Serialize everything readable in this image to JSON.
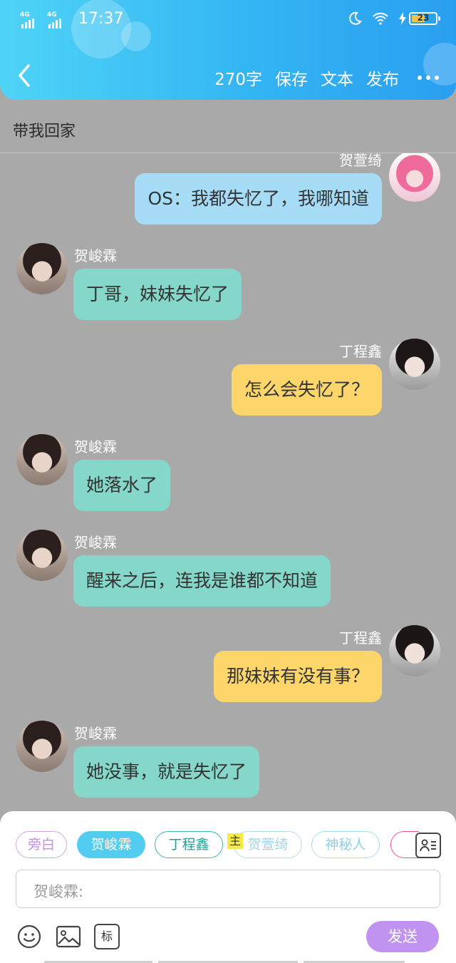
{
  "status_bar": {
    "network1": "4G",
    "network2": "4G",
    "time": "17:37",
    "battery": "23",
    "icons": [
      "moon-icon",
      "wifi-icon",
      "charging-icon",
      "battery-icon"
    ]
  },
  "header": {
    "word_count": "270字",
    "save": "保存",
    "text": "文本",
    "publish": "发布"
  },
  "title": "带我回家",
  "messages": [
    {
      "speaker": "贺萱绮",
      "text": "OS：我都失忆了，我哪知道"
    },
    {
      "speaker": "贺峻霖",
      "text": "丁哥，妹妹失忆了"
    },
    {
      "speaker": "丁程鑫",
      "text": "怎么会失忆了？"
    },
    {
      "speaker": "贺峻霖",
      "text": "她落水了"
    },
    {
      "speaker": "贺峻霖",
      "text": "醒来之后，连我是谁都不知道"
    },
    {
      "speaker": "丁程鑫",
      "text": "那妹妹有没有事？"
    },
    {
      "speaker": "贺峻霖",
      "text": "她没事，就是失忆了"
    }
  ],
  "roles": [
    "旁白",
    "贺峻霖",
    "丁程鑫",
    "贺萱绮",
    "神秘人"
  ],
  "main_role_tag": "主",
  "input": {
    "placeholder": "贺峻霖:"
  },
  "tools": {
    "tag_label": "标"
  },
  "send": "发送",
  "colors": {
    "teal": "#85d7c9",
    "yellow": "#fdd66b",
    "blue": "#a7dcf7",
    "send": "#c093f0"
  }
}
